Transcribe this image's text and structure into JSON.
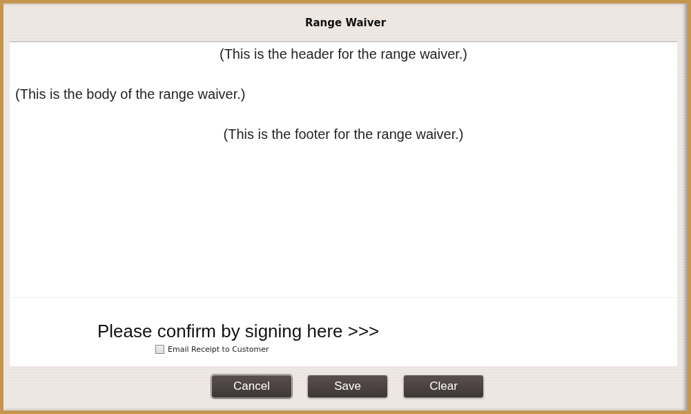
{
  "window": {
    "title": "Range Waiver"
  },
  "document": {
    "header": "(This is the header for the range waiver.)",
    "body": "(This is the body of the range waiver.)",
    "footer": "(This is the footer for the range waiver.)"
  },
  "signature": {
    "prompt": "Please confirm by signing here >>>",
    "email_receipt": {
      "label": "Email Receipt to Customer",
      "checked": false
    }
  },
  "buttons": [
    {
      "label": "Cancel",
      "focused": true
    },
    {
      "label": "Save",
      "focused": false
    },
    {
      "label": "Clear",
      "focused": false
    }
  ]
}
